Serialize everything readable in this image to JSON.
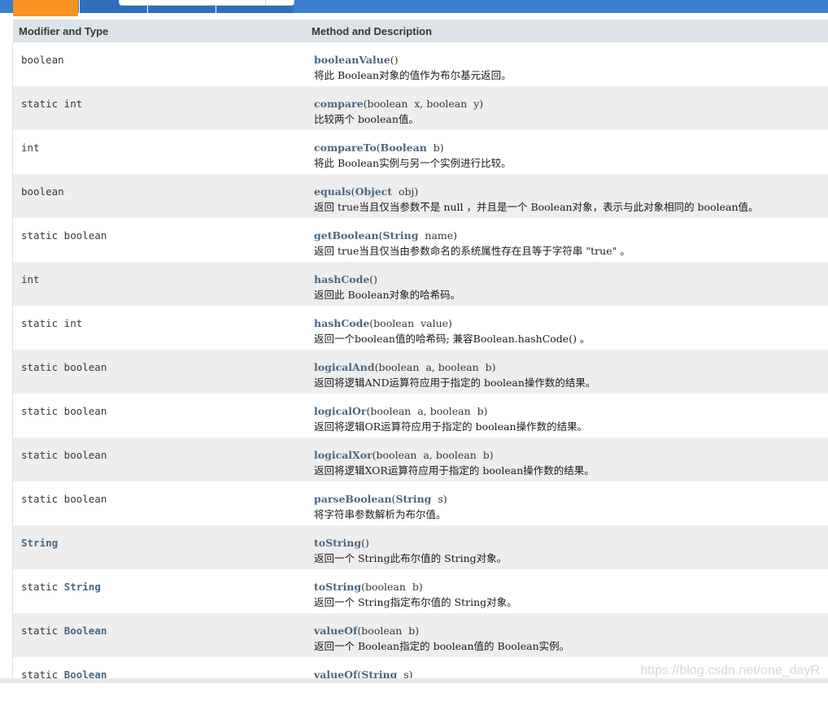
{
  "columns": {
    "modifier": "Modifier and Type",
    "method": "Method and Description"
  },
  "rows": [
    {
      "modifier_prefix": "boolean",
      "modifier_type": "",
      "method_name": "booleanValue",
      "params": "()",
      "description": "将此 Boolean对象的值作为布尔基元返回。"
    },
    {
      "modifier_prefix": "static int",
      "modifier_type": "",
      "method_name": "compare",
      "params": "(boolean  x, boolean  y)",
      "description": "比较两个 boolean值。"
    },
    {
      "modifier_prefix": "int",
      "modifier_type": "",
      "method_name": "compareTo",
      "params_type": "Boolean",
      "params": "  b)",
      "params_open": "(",
      "description": "将此 Boolean实例与另一个实例进行比较。"
    },
    {
      "modifier_prefix": "boolean",
      "modifier_type": "",
      "method_name": "equals",
      "params_open": "(",
      "params_type": "Object",
      "params": "  obj)",
      "description": "返回 true当且仅当参数不是 null ，并且是一个 Boolean对象，表示与此对象相同的 boolean值。"
    },
    {
      "modifier_prefix": "static boolean",
      "modifier_type": "",
      "method_name": "getBoolean",
      "params_open": "(",
      "params_type": "String",
      "params": "  name)",
      "description": "返回 true当且仅当由参数命名的系统属性存在且等于字符串 \"true\" 。"
    },
    {
      "modifier_prefix": "int",
      "modifier_type": "",
      "method_name": "hashCode",
      "params": "()",
      "description": "返回此 Boolean对象的哈希码。"
    },
    {
      "modifier_prefix": "static int",
      "modifier_type": "",
      "method_name": "hashCode",
      "params": "(boolean  value)",
      "description": "返回一个boolean值的哈希码; 兼容Boolean.hashCode() 。"
    },
    {
      "modifier_prefix": "static boolean",
      "modifier_type": "",
      "method_name": "logicalAnd",
      "params": "(boolean  a, boolean  b)",
      "description": "返回将逻辑AND运算符应用于指定的 boolean操作数的结果。"
    },
    {
      "modifier_prefix": "static boolean",
      "modifier_type": "",
      "method_name": "logicalOr",
      "params": "(boolean  a, boolean  b)",
      "description": "返回将逻辑OR运算符应用于指定的 boolean操作数的结果。"
    },
    {
      "modifier_prefix": "static boolean",
      "modifier_type": "",
      "method_name": "logicalXor",
      "params": "(boolean  a, boolean  b)",
      "description": "返回将逻辑XOR运算符应用于指定的 boolean操作数的结果。"
    },
    {
      "modifier_prefix": "static boolean",
      "modifier_type": "",
      "method_name": "parseBoolean",
      "params_open": "(",
      "params_type": "String",
      "params": "  s)",
      "description": "将字符串参数解析为布尔值。"
    },
    {
      "modifier_prefix": "",
      "modifier_type": "String",
      "method_name": "toString",
      "params": "()",
      "description": "返回一个 String此布尔值的 String对象。"
    },
    {
      "modifier_prefix": "static ",
      "modifier_type": "String",
      "method_name": "toString",
      "params": "(boolean  b)",
      "description": "返回一个 String指定布尔值的 String对象。"
    },
    {
      "modifier_prefix": "static ",
      "modifier_type": "Boolean",
      "method_name": "valueOf",
      "params": "(boolean  b)",
      "description": "返回一个 Boolean指定的 boolean值的 Boolean实例。"
    },
    {
      "modifier_prefix": "static ",
      "modifier_type": "Boolean",
      "method_name": "valueOf",
      "params_open": "(",
      "params_type": "String",
      "params": "  s)",
      "description": ""
    }
  ],
  "watermark": "https://blog.csdn.net/one_dayR",
  "colors": {
    "header_bar": "#3b7ecf",
    "active_tab": "#f89223",
    "table_header_bg": "#dee3e9",
    "alt_row_bg": "#eeeeef",
    "link": "#4a6782"
  }
}
